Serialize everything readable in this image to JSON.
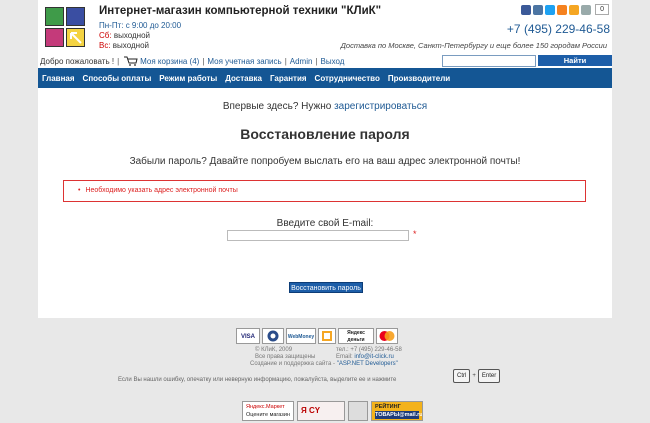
{
  "header": {
    "shop_title": "Интернет-магазин компьютерной техники \"КЛиК\"",
    "hours_weekdays": "Пн-Пт: с 9:00 до 20:00",
    "hours_sat_label": "Сб:",
    "hours_sat_value": "выходной",
    "hours_sun_label": "Вс:",
    "hours_sun_value": "выходной",
    "phone": "+7 (495) 229-46-58",
    "delivery": "Доставка по Москве, Санкт-Петербургу и еще более 150 городам России",
    "share_count": "0"
  },
  "userbar": {
    "welcome": "Добро пожаловать !",
    "sep1": "|",
    "cart": "Моя корзина (4)",
    "account": "Моя учетная запись",
    "admin": "Admin",
    "logout": "Выход",
    "search_button": "Найти"
  },
  "nav": [
    "Главная",
    "Способы оплаты",
    "Режим работы",
    "Доставка",
    "Гарантия",
    "Сотрудничество",
    "Производители"
  ],
  "content": {
    "first_visit_text": "Впервые здесь? Нужно",
    "register_link": "зарегистрироваться",
    "title": "Восстановление пароля",
    "subtitle": "Забыли пароль? Давайте попробуем выслать его на ваш адрес электронной почты!",
    "error_message": "Необходимо указать адрес электронной почты",
    "email_label": "Введите свой E-mail:",
    "email_value": "",
    "required_mark": "*",
    "restore_button": "Восстановить пароль"
  },
  "footer": {
    "payments": [
      "VISA",
      "",
      "WebMoney",
      "",
      "Яндекс деньги",
      ""
    ],
    "copyright_line1": "© КЛиК, 2009",
    "copyright_line2": "Все права защищены",
    "phone_line": "тел.: +7 (495) 229-46-58",
    "email_label": "Email:",
    "email": "info@it-click.ru",
    "created_text": "Создание и поддержка сайта -",
    "created_link": "\"ASP.NET Developers\"",
    "error_note": "Если Вы нашли ошибку, опечатку или неверную информацию, пожалуйста, выделите ее и нажмите",
    "key_ctrl": "Ctrl",
    "key_plus": "+",
    "key_enter": "Enter",
    "badge_market_1": "Яндекс.Маркет",
    "badge_market_2": "Оцените магазин",
    "badge_cy": "Я CY",
    "badge_rating_1": "РЕЙТИНГ",
    "badge_rating_2": "ТОВАРЫ@mail.ru"
  },
  "colors": {
    "nav_bg": "#145694",
    "link": "#1f5a94",
    "error": "#d22222",
    "button_bg": "#1d5ea8"
  }
}
